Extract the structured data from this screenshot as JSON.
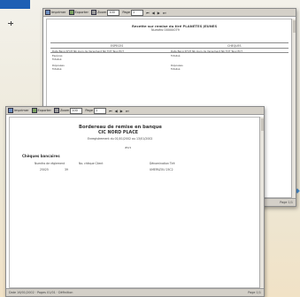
{
  "back_window": {
    "toolbar": {
      "print_label": "Imprimer",
      "export_label": "Exporter",
      "zoom_label": "Zoom",
      "page_label": "Page",
      "zoom_value": "100",
      "page_value": "1"
    },
    "report": {
      "title": "Recette sur remise du tiré PLANETES JEUNES",
      "subtitle": "Numéro 00000079",
      "section_left": "ESPECES",
      "section_right": "CHEQUES",
      "row_labels": [
        "Espèces",
        "Totalisé",
        "Déposées",
        "Totalisé"
      ],
      "col_header_left": "Date  Banq N°CH  Nb Jours de Versement  Nb  TOT  Taux  ECT",
      "col_header_right": "Date  Banq N°CH  Nb Jours de Versement  Nb  TOT  Taux  ECT"
    },
    "status_right": "Page 1/1"
  },
  "front_window": {
    "toolbar": {
      "print_label": "Imprimer",
      "export_label": "Exporter",
      "zoom_label": "Zoom",
      "page_label": "Page",
      "zoom_value": "100",
      "page_value": "1"
    },
    "report": {
      "title": "Bordereau de remise en banque",
      "bank": "CIC NORD PLACE",
      "date_line": "Enregistrement du 01/01/2002 au 13/01/2002",
      "page_marker": "#0/1",
      "section": "Chèques bancaires",
      "col_headers": [
        "Numéro de règlement",
        "No. chèque Client",
        "Dénomination Tiré"
      ],
      "row_values": [
        "25025",
        "39",
        "UMEPAZOU 25C2"
      ]
    },
    "status_left": "Date 16/01/2002 · Pages 01/01 · Définition",
    "status_right": "Page 1/1"
  },
  "colors": {
    "accent_blue": "#1e5fb4",
    "toolbar_gray": "#d4d0c8"
  }
}
